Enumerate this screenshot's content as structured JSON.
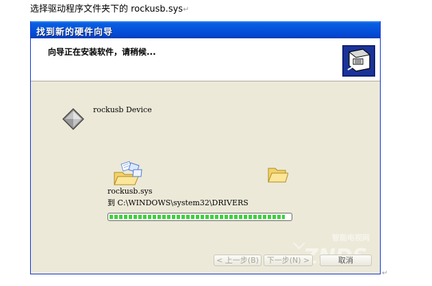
{
  "caption": {
    "text": "选择驱动程序文件夹下的 rockusb.sys",
    "return_mark": "↵"
  },
  "dialog": {
    "title": "找到新的硬件向导",
    "header_text": "向导正在安装软件，请稍候...",
    "header_icon": "hardware-wizard-icon",
    "device": {
      "icon": "device-diamond-icon",
      "name": "rockusb Device"
    },
    "copy": {
      "source_icon": "flying-papers-folder-icon",
      "dest_icon": "folder-icon",
      "file_name": "rockusb.sys",
      "destination": "到 C:\\WINDOWS\\system32\\DRIVERS",
      "progress": 0.97
    },
    "buttons": {
      "back": "< 上一步(B)",
      "next": "下一步(N) >",
      "cancel": "取消"
    },
    "watermark": {
      "top_text": "智能电视网",
      "brand": "ZNDS"
    }
  },
  "colors": {
    "titlebar": "#0553dc",
    "dialog_face": "#ece9d8",
    "progress_fill": "#3cd23c"
  }
}
